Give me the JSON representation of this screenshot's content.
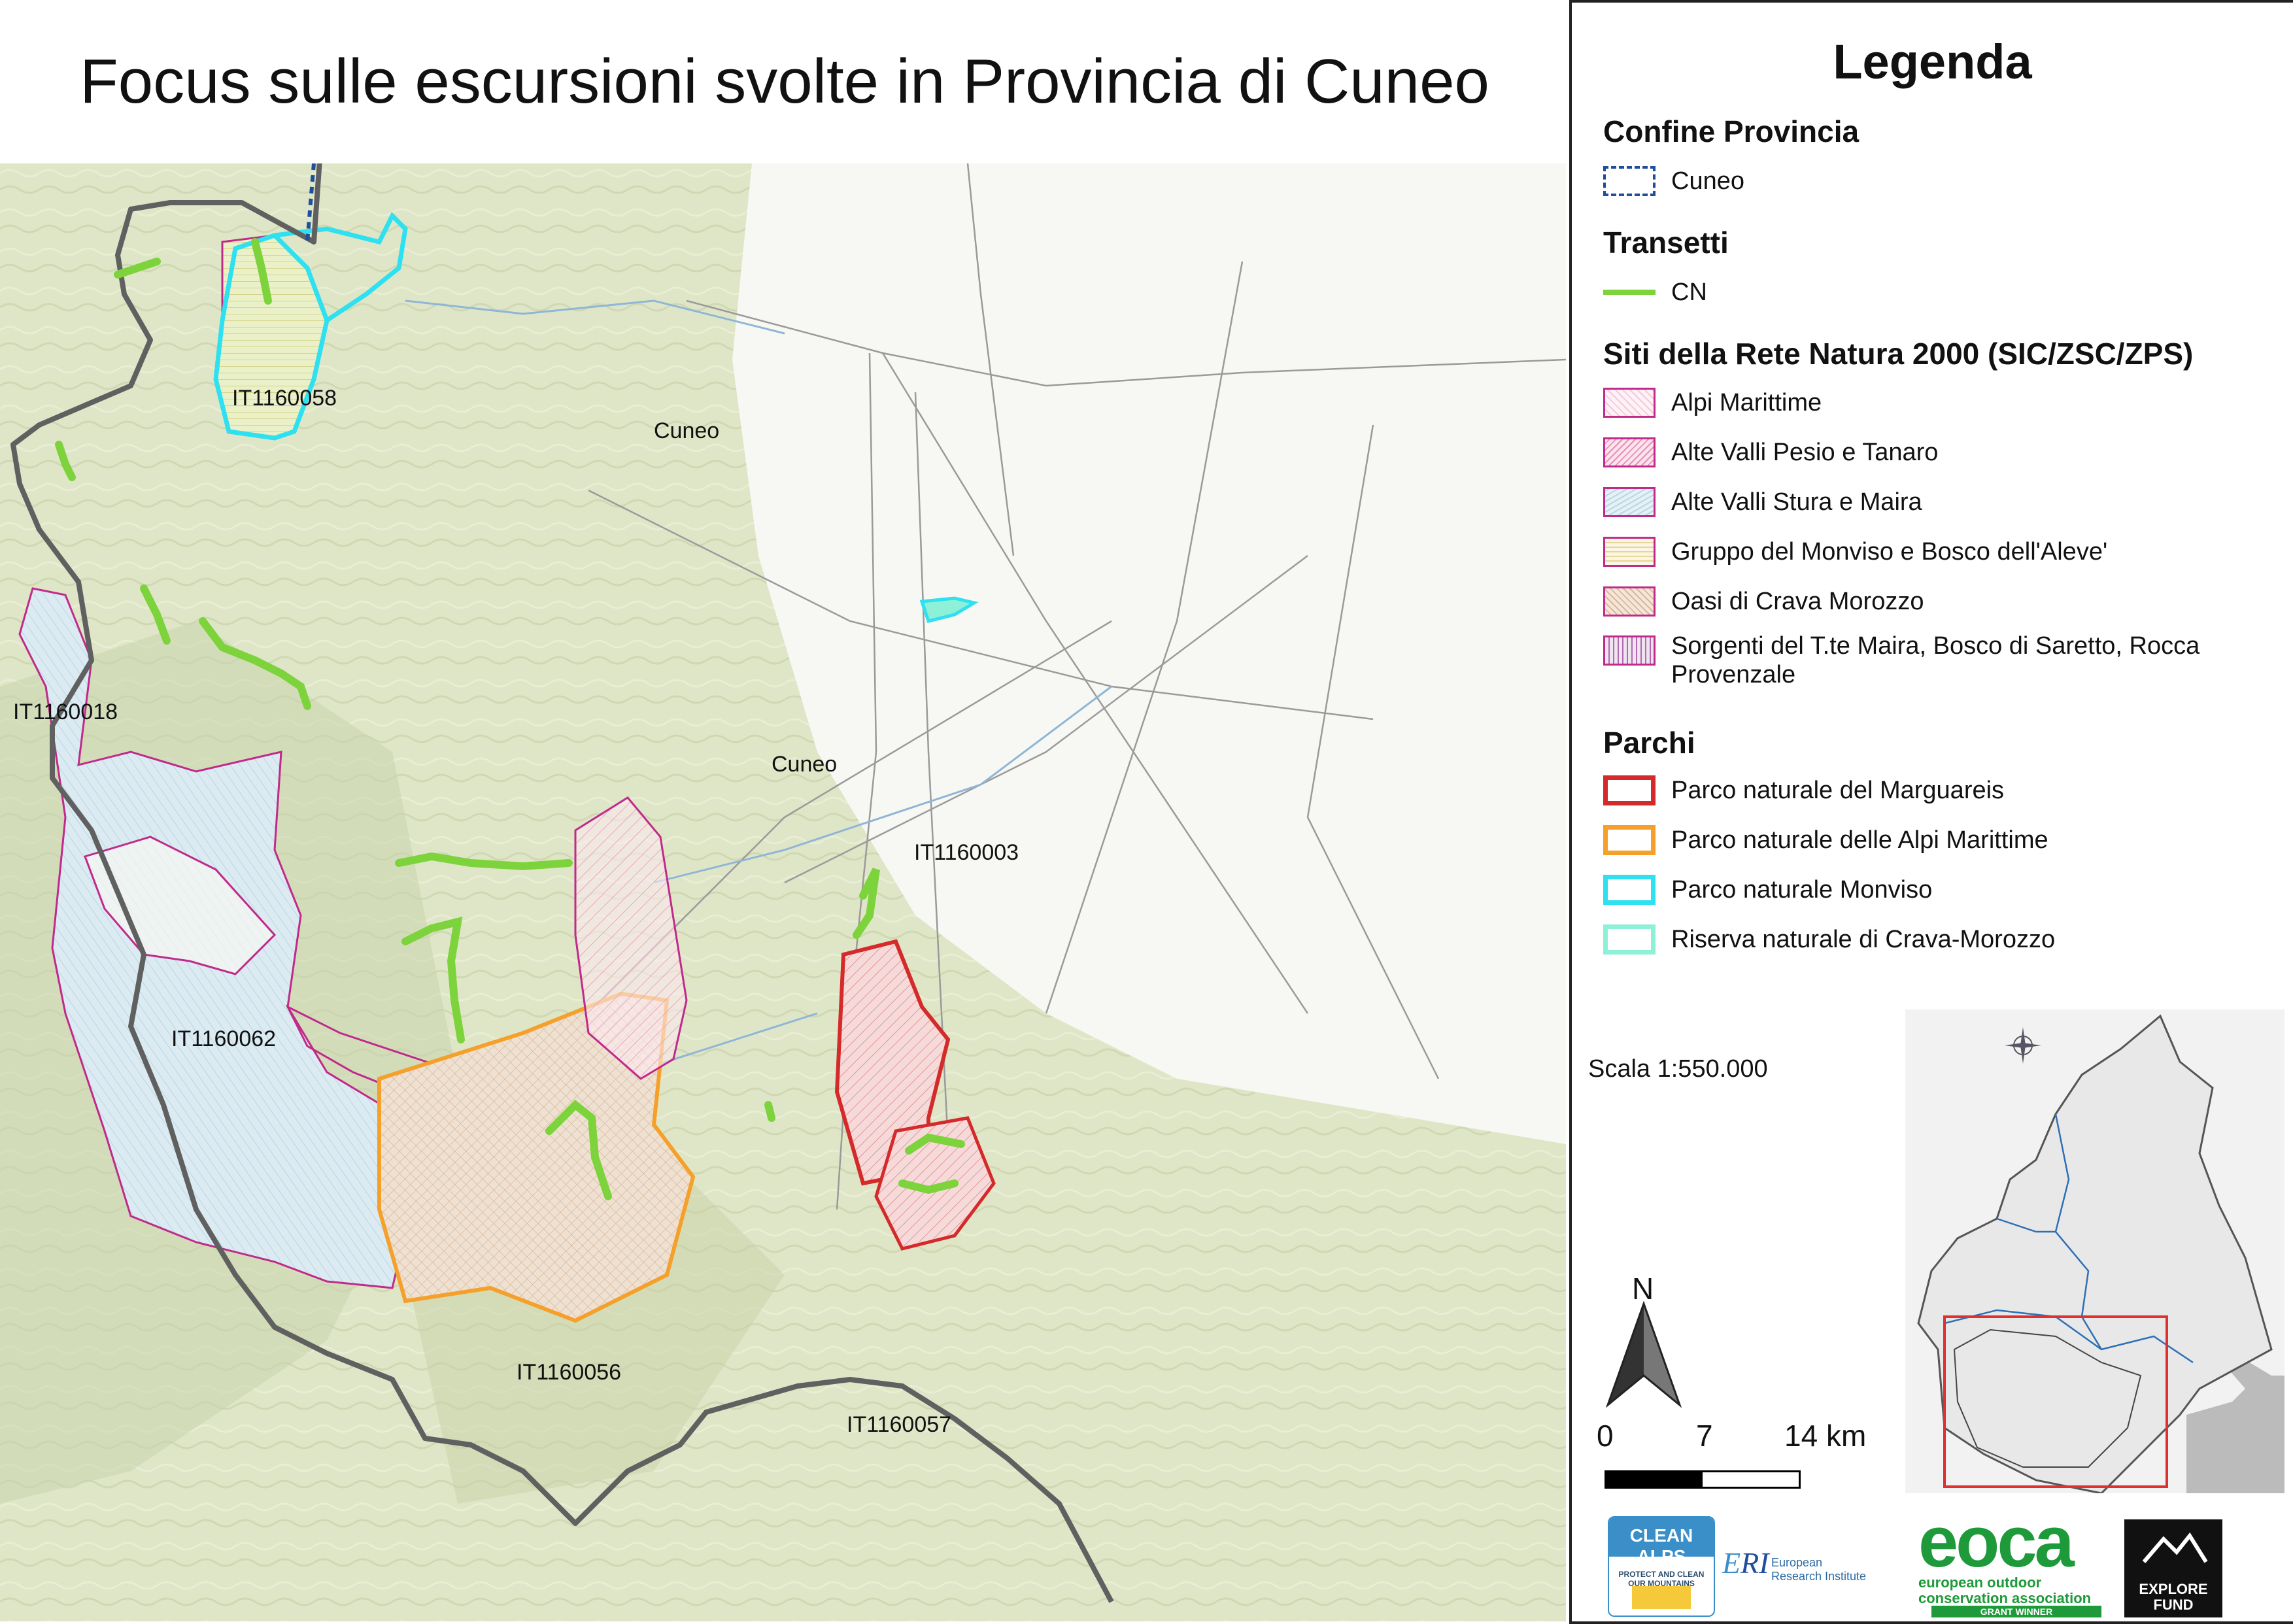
{
  "title": "Focus sulle escursioni svolte in Provincia di Cuneo",
  "map": {
    "site_labels": [
      "IT1160058",
      "IT1160018",
      "IT1160062",
      "IT1160056",
      "IT1160057",
      "IT1160003"
    ],
    "place_labels": [
      "Cuneo",
      "Cuneo"
    ]
  },
  "legend": {
    "title": "Legenda",
    "sections": [
      {
        "heading": "Confine Provincia",
        "items": [
          {
            "label": "Cuneo",
            "style": "dashed-border",
            "color": "#1f4e9c"
          }
        ]
      },
      {
        "heading": "Transetti",
        "items": [
          {
            "label": "CN",
            "style": "line",
            "color": "#7dd33c"
          }
        ]
      },
      {
        "heading": "Siti della Rete Natura 2000 (SIC/ZSC/ZPS)",
        "items": [
          {
            "label": "Alpi Marittime",
            "style": "hatch-pink",
            "color": "#c02a8a"
          },
          {
            "label": "Alte Valli Pesio e Tanaro",
            "style": "hatch-pink-diag",
            "color": "#c02a8a"
          },
          {
            "label": "Alte Valli Stura e Maira",
            "style": "hatch-blue",
            "color": "#c02a8a"
          },
          {
            "label": "Gruppo del Monviso e Bosco dell'Aleve'",
            "style": "hatch-yellow",
            "color": "#c02a8a"
          },
          {
            "label": "Oasi di Crava Morozzo",
            "style": "hatch-brown",
            "color": "#c02a8a"
          },
          {
            "label": "Sorgenti del T.te Maira, Bosco di Saretto, Rocca Provenzale",
            "style": "hatch-vert",
            "color": "#c02a8a"
          }
        ]
      },
      {
        "heading": "Parchi",
        "items": [
          {
            "label": "Parco naturale del Marguareis",
            "style": "box",
            "color": "#d42a2a"
          },
          {
            "label": "Parco naturale delle Alpi Marittime",
            "style": "box",
            "color": "#f5a02a"
          },
          {
            "label": "Parco naturale Monviso",
            "style": "box",
            "color": "#2ee0f0"
          },
          {
            "label": "Riserva naturale di Crava-Morozzo",
            "style": "box",
            "color": "#8ff0d8"
          }
        ]
      }
    ],
    "scale_text": "Scala 1:550.000",
    "north_letter": "N",
    "scalebar": [
      "0",
      "7",
      "14 km"
    ],
    "logos": {
      "clean_alps": "CLEAN ALPS",
      "clean_alps_sub": "PROTECT AND CLEAN OUR MOUNTAINS",
      "eri": "European Research Institute",
      "eoca": "eoca",
      "eoca_sub": "european outdoor conservation association",
      "eoca_badge": "GRANT WINNER",
      "explore_fund": "EXPLORE FUND"
    }
  }
}
